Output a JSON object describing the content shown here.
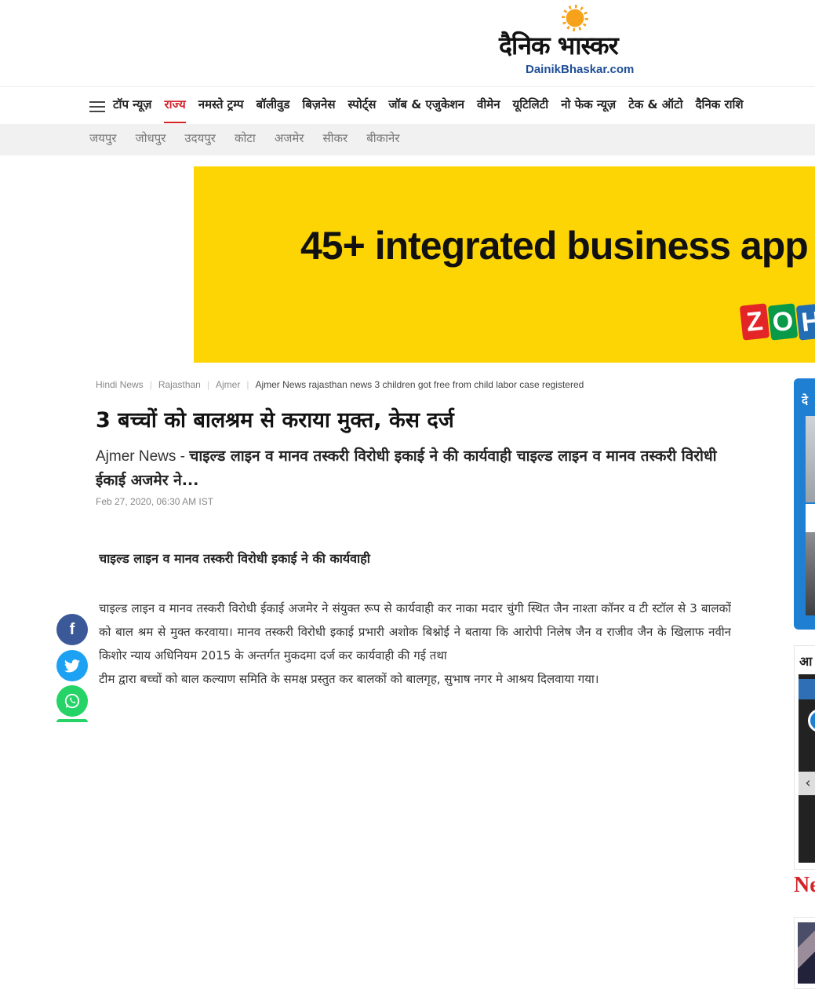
{
  "header": {
    "logo_hindi": "दैनिक भास्कर",
    "logo_en_part1": "Dainik",
    "logo_en_part2": "Bhaskar.com"
  },
  "nav": {
    "items": [
      {
        "label": "टॉप न्यूज़",
        "active": false
      },
      {
        "label": "राज्य",
        "active": true
      },
      {
        "label": "नमस्ते ट्रम्प",
        "active": false
      },
      {
        "label": "बॉलीवुड",
        "active": false
      },
      {
        "label": "बिज़नेस",
        "active": false
      },
      {
        "label": "स्पोर्ट्स",
        "active": false
      },
      {
        "label": "जॉब & एजुकेशन",
        "active": false
      },
      {
        "label": "वीमेन",
        "active": false
      },
      {
        "label": "यूटिलिटी",
        "active": false
      },
      {
        "label": "नो फेक न्यूज़",
        "active": false
      },
      {
        "label": "टेक & ऑटो",
        "active": false
      },
      {
        "label": "दैनिक राशि",
        "active": false
      }
    ],
    "sub_items": [
      "जयपुर",
      "जोधपुर",
      "उदयपुर",
      "कोटा",
      "अजमेर",
      "सीकर",
      "बीकानेर"
    ]
  },
  "ad": {
    "headline": "45+ integrated business app",
    "brand_letters": [
      "Z",
      "O",
      "H"
    ],
    "brand_colors": [
      "#e42527",
      "#089949",
      "#226db4"
    ],
    "background": "#fdd504"
  },
  "article": {
    "breadcrumb": [
      "Hindi News",
      "Rajasthan",
      "Ajmer",
      "Ajmer News rajasthan news 3 children got free from child labor case registered"
    ],
    "headline": "3 बच्चों को बालश्रम से कराया मुक्त, केस दर्ज",
    "summary_city": "Ajmer News - ",
    "summary_text": "चाइल्ड लाइन व मानव तस्करी विरोधी इकाई ने की कार्यवाही चाइल्ड लाइन व मानव तस्करी विरोधी ईकाई अजमेर ने...",
    "dateline": "Feb 27, 2020, 06:30 AM IST",
    "subhead": "चाइल्ड लाइन व मानव तस्करी विरोधी इकाई ने की कार्यवाही",
    "paragraph1": "चाइल्ड लाइन व मानव तस्करी विरोधी ईकाई अजमेर ने संयुक्त रूप से कार्यवाही कर नाका मदार चुंगी स्थित जैन नाश्ता कॉनर व टी स्टॉल से 3 बालकों को बाल श्रम से मुक्त करवाया। मानव तस्करी विरोधी इकाई प्रभारी अशोक बिश्नोई ने बताया कि आरोपी निलेष जैन व राजीव जैन के खिलाफ नवीन किशोर न्याय अधिनियम 2015 के अन्तर्गत मुकदमा दर्ज कर कार्यवाही की गई तथा",
    "paragraph2": "टीम द्वारा बच्चों को बाल कल्याण समिति के समक्ष प्रस्तुत कर बालकों को बालगृह, सुभाष नगर मे आश्रय दिलवाया गया।"
  },
  "share": {
    "facebook_icon": "facebook-icon",
    "twitter_icon": "twitter-icon",
    "whatsapp_icon": "whatsapp-icon",
    "facebook_glyph": "f",
    "whatsapp_glyph": "✆"
  },
  "sidebar": {
    "box1_title": "दे",
    "box1_arrow": "‹",
    "box2_title": "आ",
    "box2_arrow": "‹",
    "ne_label": "Ne"
  },
  "colors": {
    "accent": "#d4232a",
    "sidebar_blue": "#1f7fd2"
  }
}
